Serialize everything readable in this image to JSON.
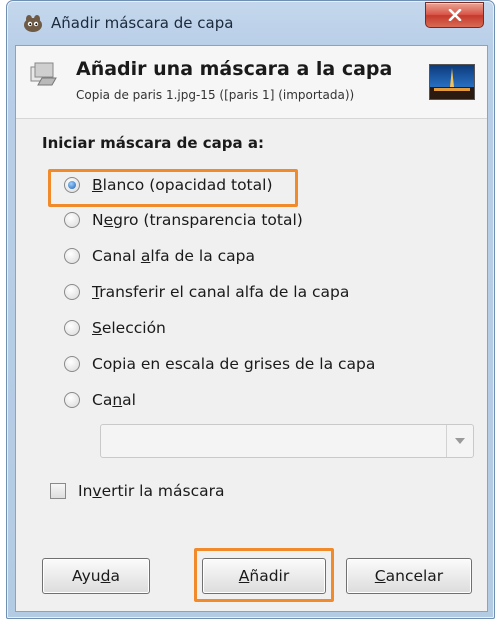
{
  "window": {
    "title": "Añadir máscara de capa",
    "close_symbol": "x"
  },
  "header": {
    "title": "Añadir una máscara a la capa",
    "subtitle": "Copia de paris 1.jpg-15 ([paris 1] (importada))"
  },
  "section": {
    "title": "Iniciar máscara de capa a:"
  },
  "options": [
    {
      "pre": "",
      "key": "B",
      "post": "lanco (opacidad total)",
      "checked": true
    },
    {
      "pre": "N",
      "key": "e",
      "post": "gro (transparencia total)",
      "checked": false
    },
    {
      "pre": "Canal ",
      "key": "a",
      "post": "lfa de la capa",
      "checked": false
    },
    {
      "pre": "",
      "key": "T",
      "post": "ransferir el canal alfa de la capa",
      "checked": false
    },
    {
      "pre": "",
      "key": "S",
      "post": "elección",
      "checked": false
    },
    {
      "pre": "Copia en escala de grises de la capa",
      "key": "",
      "post": "",
      "checked": false
    },
    {
      "pre": "Ca",
      "key": "n",
      "post": "al",
      "checked": false
    }
  ],
  "channel_combo": {
    "value": ""
  },
  "invert": {
    "pre": "In",
    "key": "v",
    "post": "ertir la máscara",
    "checked": false
  },
  "buttons": {
    "help": {
      "pre": "Ayu",
      "key": "d",
      "post": "a"
    },
    "add": {
      "pre": "",
      "key": "A",
      "post": "ñadir"
    },
    "cancel": {
      "pre": "",
      "key": "C",
      "post": "ancelar"
    }
  },
  "colors": {
    "highlight": "#f08a2a",
    "radio_selected": "#1a5fb4",
    "close_button": "#d9574a"
  },
  "icons": {
    "app": "gimp-wilber-icon",
    "header": "layer-mask-icon",
    "thumbnail": "paris-night-thumbnail",
    "close": "close-icon",
    "combo": "chevron-down-icon"
  }
}
